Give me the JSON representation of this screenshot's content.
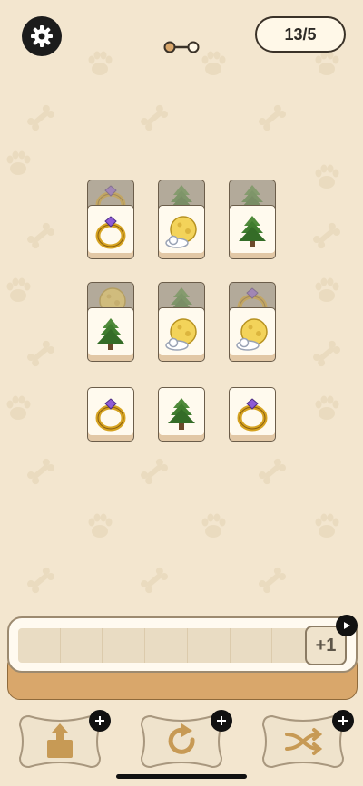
{
  "header": {
    "level_text": "13/5",
    "settings_icon": "gear-icon",
    "progress_icon": "two-node-progress-icon"
  },
  "board": {
    "tiles": [
      {
        "icon": "ring",
        "state": "back"
      },
      {
        "icon": "tree",
        "state": "back"
      },
      {
        "icon": "tree",
        "state": "back"
      },
      {
        "icon": "ring",
        "state": "front"
      },
      {
        "icon": "moon",
        "state": "front"
      },
      {
        "icon": "tree",
        "state": "front"
      },
      {
        "icon": "moon",
        "state": "back"
      },
      {
        "icon": "tree",
        "state": "back"
      },
      {
        "icon": "ring",
        "state": "back"
      },
      {
        "icon": "tree",
        "state": "front"
      },
      {
        "icon": "moon",
        "state": "front"
      },
      {
        "icon": "moon",
        "state": "front"
      },
      {
        "icon": "ring",
        "state": "front"
      },
      {
        "icon": "tree",
        "state": "front"
      },
      {
        "icon": "ring",
        "state": "front"
      }
    ]
  },
  "tray": {
    "slot_count": 7,
    "extra_slot_label": "+1",
    "extra_slot_badge_icon": "play-icon"
  },
  "powerups": [
    {
      "name": "undo-out",
      "icon": "box-upload-icon"
    },
    {
      "name": "undo",
      "icon": "rotate-icon"
    },
    {
      "name": "shuffle",
      "icon": "shuffle-icon"
    }
  ],
  "colors": {
    "background": "#f3e6cf",
    "tile_face": "#fffaee",
    "tile_back": "#b3aa9a",
    "accent_brown": "#d9a76b"
  }
}
